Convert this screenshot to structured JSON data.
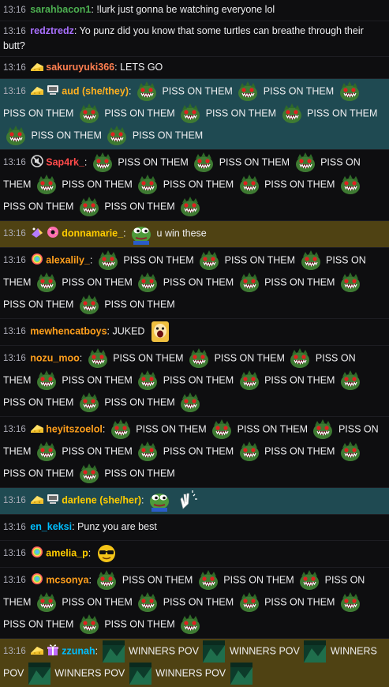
{
  "chat": {
    "messages": [
      {
        "time": "13:16",
        "user": "sarahbacon1",
        "color": "#4caf50",
        "badges": [],
        "hl": "",
        "parts": [
          {
            "t": "text",
            "v": "!lurk just gonna be watching everyone lol"
          }
        ],
        "plain": true
      },
      {
        "time": "13:16",
        "user": "redztredz",
        "color": "#a970ff",
        "badges": [],
        "hl": "",
        "parts": [
          {
            "t": "text",
            "v": "Yo punz did you know that some turtles can breathe through their butt?"
          }
        ],
        "plain": true
      },
      {
        "time": "13:16",
        "user": "sakuruyuki366",
        "color": "#ff7f50",
        "badges": [
          "cheese-badge"
        ],
        "hl": "",
        "parts": [
          {
            "t": "text",
            "v": "LETS GO"
          }
        ],
        "plain": true
      },
      {
        "time": "13:16",
        "user": "aud (she/they)",
        "color": "#ffb020",
        "badges": [
          "cheese-badge",
          "computer-badge"
        ],
        "hl": "teal",
        "parts": [
          {
            "t": "emote",
            "v": "plant-monster-emote"
          },
          {
            "t": "text",
            "v": "PISS ON THEM"
          },
          {
            "t": "emote",
            "v": "plant-monster-emote"
          },
          {
            "t": "text",
            "v": "PISS ON THEM"
          },
          {
            "t": "emote",
            "v": "plant-monster-emote"
          },
          {
            "t": "text",
            "v": "PISS ON THEM"
          },
          {
            "t": "emote",
            "v": "plant-monster-emote"
          },
          {
            "t": "text",
            "v": "PISS ON THEM"
          },
          {
            "t": "emote",
            "v": "plant-monster-emote"
          },
          {
            "t": "text",
            "v": "PISS ON THEM"
          },
          {
            "t": "emote",
            "v": "plant-monster-emote"
          },
          {
            "t": "text",
            "v": "PISS ON THEM"
          },
          {
            "t": "emote",
            "v": "plant-monster-emote"
          },
          {
            "t": "text",
            "v": "PISS ON THEM"
          },
          {
            "t": "emote",
            "v": "plant-monster-emote"
          },
          {
            "t": "text",
            "v": "PISS ON THEM"
          }
        ]
      },
      {
        "time": "13:16",
        "user": "Sap4rk_",
        "color": "#ff4a4a",
        "badges": [
          "no-audio-badge"
        ],
        "hl": "",
        "parts": [
          {
            "t": "text",
            "v": ":"
          },
          {
            "t": "emote",
            "v": "plant-monster-emote"
          },
          {
            "t": "text",
            "v": "PISS ON THEM"
          },
          {
            "t": "emote",
            "v": "plant-monster-emote"
          },
          {
            "t": "text",
            "v": "PISS ON THEM"
          },
          {
            "t": "emote",
            "v": "plant-monster-emote"
          },
          {
            "t": "text",
            "v": "PISS ON THEM"
          },
          {
            "t": "emote",
            "v": "plant-monster-emote"
          },
          {
            "t": "text",
            "v": "PISS ON THEM"
          },
          {
            "t": "emote",
            "v": "plant-monster-emote"
          },
          {
            "t": "text",
            "v": "PISS ON THEM"
          },
          {
            "t": "emote",
            "v": "plant-monster-emote"
          },
          {
            "t": "text",
            "v": "PISS ON THEM"
          },
          {
            "t": "emote",
            "v": "plant-monster-emote"
          },
          {
            "t": "text",
            "v": "PISS ON THEM"
          },
          {
            "t": "emote",
            "v": "plant-monster-emote"
          },
          {
            "t": "text",
            "v": "PISS ON THEM"
          },
          {
            "t": "emote",
            "v": "plant-monster-emote"
          }
        ]
      },
      {
        "time": "13:16",
        "user": "donnamarie_",
        "color": "#ffcc00",
        "badges": [
          "prism-badge",
          "donut-badge"
        ],
        "hl": "gold",
        "parts": [
          {
            "t": "text",
            "v": ":"
          },
          {
            "t": "emote",
            "v": "pepe-emote"
          },
          {
            "t": "text",
            "v": "u win these"
          }
        ]
      },
      {
        "time": "13:16",
        "user": "alexalily_",
        "color": "#ff9f1c",
        "badges": [
          "rainbow-badge"
        ],
        "hl": "",
        "parts": [
          {
            "t": "text",
            "v": ":"
          },
          {
            "t": "emote",
            "v": "plant-monster-emote"
          },
          {
            "t": "text",
            "v": "PISS ON THEM"
          },
          {
            "t": "emote",
            "v": "plant-monster-emote"
          },
          {
            "t": "text",
            "v": "PISS ON THEM"
          },
          {
            "t": "emote",
            "v": "plant-monster-emote"
          },
          {
            "t": "text",
            "v": "PISS ON THEM"
          },
          {
            "t": "emote",
            "v": "plant-monster-emote"
          },
          {
            "t": "text",
            "v": "PISS ON THEM"
          },
          {
            "t": "emote",
            "v": "plant-monster-emote"
          },
          {
            "t": "text",
            "v": "PISS ON THEM"
          },
          {
            "t": "emote",
            "v": "plant-monster-emote"
          },
          {
            "t": "text",
            "v": "PISS ON THEM"
          },
          {
            "t": "emote",
            "v": "plant-monster-emote"
          },
          {
            "t": "text",
            "v": "PISS ON THEM"
          },
          {
            "t": "emote",
            "v": "plant-monster-emote"
          },
          {
            "t": "text",
            "v": "PISS ON THEM"
          }
        ]
      },
      {
        "time": "13:16",
        "user": "mewhencatboys",
        "color": "#ff9f1c",
        "badges": [],
        "hl": "",
        "parts": [
          {
            "t": "text",
            "v": "JUKED"
          },
          {
            "t": "emote",
            "v": "screaming-face-emote"
          }
        ]
      },
      {
        "time": "13:16",
        "user": "nozu_moo",
        "color": "#ff9f1c",
        "badges": [],
        "hl": "",
        "parts": [
          {
            "t": "text",
            "v": ":"
          },
          {
            "t": "emote",
            "v": "plant-monster-emote"
          },
          {
            "t": "text",
            "v": "PISS ON THEM"
          },
          {
            "t": "emote",
            "v": "plant-monster-emote"
          },
          {
            "t": "text",
            "v": "PISS ON THEM"
          },
          {
            "t": "emote",
            "v": "plant-monster-emote"
          },
          {
            "t": "text",
            "v": "PISS ON THEM"
          },
          {
            "t": "emote",
            "v": "plant-monster-emote"
          },
          {
            "t": "text",
            "v": "PISS ON THEM"
          },
          {
            "t": "emote",
            "v": "plant-monster-emote"
          },
          {
            "t": "text",
            "v": "PISS ON THEM"
          },
          {
            "t": "emote",
            "v": "plant-monster-emote"
          },
          {
            "t": "text",
            "v": "PISS ON THEM"
          },
          {
            "t": "emote",
            "v": "plant-monster-emote"
          },
          {
            "t": "text",
            "v": "PISS ON THEM"
          },
          {
            "t": "emote",
            "v": "plant-monster-emote"
          },
          {
            "t": "text",
            "v": "PISS ON THEM"
          },
          {
            "t": "emote",
            "v": "plant-monster-emote"
          }
        ]
      },
      {
        "time": "13:16",
        "user": "heyitszoelol",
        "color": "#ff9f1c",
        "badges": [
          "cheese-badge"
        ],
        "hl": "",
        "parts": [
          {
            "t": "text",
            "v": ":"
          },
          {
            "t": "emote",
            "v": "plant-monster-emote"
          },
          {
            "t": "text",
            "v": "PISS ON THEM"
          },
          {
            "t": "emote",
            "v": "plant-monster-emote"
          },
          {
            "t": "text",
            "v": "PISS ON THEM"
          },
          {
            "t": "emote",
            "v": "plant-monster-emote"
          },
          {
            "t": "text",
            "v": "PISS ON THEM"
          },
          {
            "t": "emote",
            "v": "plant-monster-emote"
          },
          {
            "t": "text",
            "v": "PISS ON THEM"
          },
          {
            "t": "emote",
            "v": "plant-monster-emote"
          },
          {
            "t": "text",
            "v": "PISS ON THEM"
          },
          {
            "t": "emote",
            "v": "plant-monster-emote"
          },
          {
            "t": "text",
            "v": "PISS ON THEM"
          },
          {
            "t": "emote",
            "v": "plant-monster-emote"
          },
          {
            "t": "text",
            "v": "PISS ON THEM"
          },
          {
            "t": "emote",
            "v": "plant-monster-emote"
          },
          {
            "t": "text",
            "v": "PISS ON THEM"
          }
        ]
      },
      {
        "time": "13:16",
        "user": "darlene (she/her)",
        "color": "#ffcc00",
        "badges": [
          "cheese-badge",
          "computer-badge"
        ],
        "hl": "teal",
        "parts": [
          {
            "t": "text",
            "v": ":"
          },
          {
            "t": "emote",
            "v": "pepe-emote"
          },
          {
            "t": "emote",
            "v": "clap-hands-emote"
          }
        ]
      },
      {
        "time": "13:16",
        "user": "en_keksi",
        "color": "#00bfff",
        "badges": [],
        "hl": "",
        "parts": [
          {
            "t": "text",
            "v": "Punz you are best"
          }
        ]
      },
      {
        "time": "13:16",
        "user": "amelia_p",
        "color": "#ffcc00",
        "badges": [
          "rainbow-badge"
        ],
        "hl": "",
        "parts": [
          {
            "t": "text",
            "v": ":"
          },
          {
            "t": "emote",
            "v": "sunglasses-emote"
          }
        ]
      },
      {
        "time": "13:16",
        "user": "mcsonya",
        "color": "#ff9f1c",
        "badges": [
          "rainbow-badge"
        ],
        "hl": "",
        "parts": [
          {
            "t": "text",
            "v": ":"
          },
          {
            "t": "emote",
            "v": "plant-monster-emote"
          },
          {
            "t": "text",
            "v": "PISS ON THEM"
          },
          {
            "t": "emote",
            "v": "plant-monster-emote"
          },
          {
            "t": "text",
            "v": "PISS ON THEM"
          },
          {
            "t": "emote",
            "v": "plant-monster-emote"
          },
          {
            "t": "text",
            "v": "PISS ON THEM"
          },
          {
            "t": "emote",
            "v": "plant-monster-emote"
          },
          {
            "t": "text",
            "v": "PISS ON THEM"
          },
          {
            "t": "emote",
            "v": "plant-monster-emote"
          },
          {
            "t": "text",
            "v": "PISS ON THEM"
          },
          {
            "t": "emote",
            "v": "plant-monster-emote"
          },
          {
            "t": "text",
            "v": "PISS ON THEM"
          },
          {
            "t": "emote",
            "v": "plant-monster-emote"
          },
          {
            "t": "text",
            "v": "PISS ON THEM"
          },
          {
            "t": "emote",
            "v": "plant-monster-emote"
          },
          {
            "t": "text",
            "v": "PISS ON THEM"
          },
          {
            "t": "emote",
            "v": "plant-monster-emote"
          }
        ]
      },
      {
        "time": "13:16",
        "user": "zzunah",
        "color": "#00bfff",
        "badges": [
          "cheese-badge",
          "gift-badge"
        ],
        "hl": "gold",
        "parts": [
          {
            "t": "text",
            "v": ":"
          },
          {
            "t": "emote",
            "v": "winners-pov-emote"
          },
          {
            "t": "text",
            "v": "WINNERS POV"
          },
          {
            "t": "emote",
            "v": "winners-pov-emote"
          },
          {
            "t": "text",
            "v": "WINNERS POV"
          },
          {
            "t": "emote",
            "v": "winners-pov-emote"
          },
          {
            "t": "text",
            "v": "WINNERS POV"
          },
          {
            "t": "emote",
            "v": "winners-pov-emote"
          },
          {
            "t": "text",
            "v": "WINNERS POV"
          },
          {
            "t": "emote",
            "v": "winners-pov-emote"
          },
          {
            "t": "text",
            "v": "WINNERS POV"
          },
          {
            "t": "emote",
            "v": "winners-pov-emote"
          }
        ]
      }
    ]
  }
}
